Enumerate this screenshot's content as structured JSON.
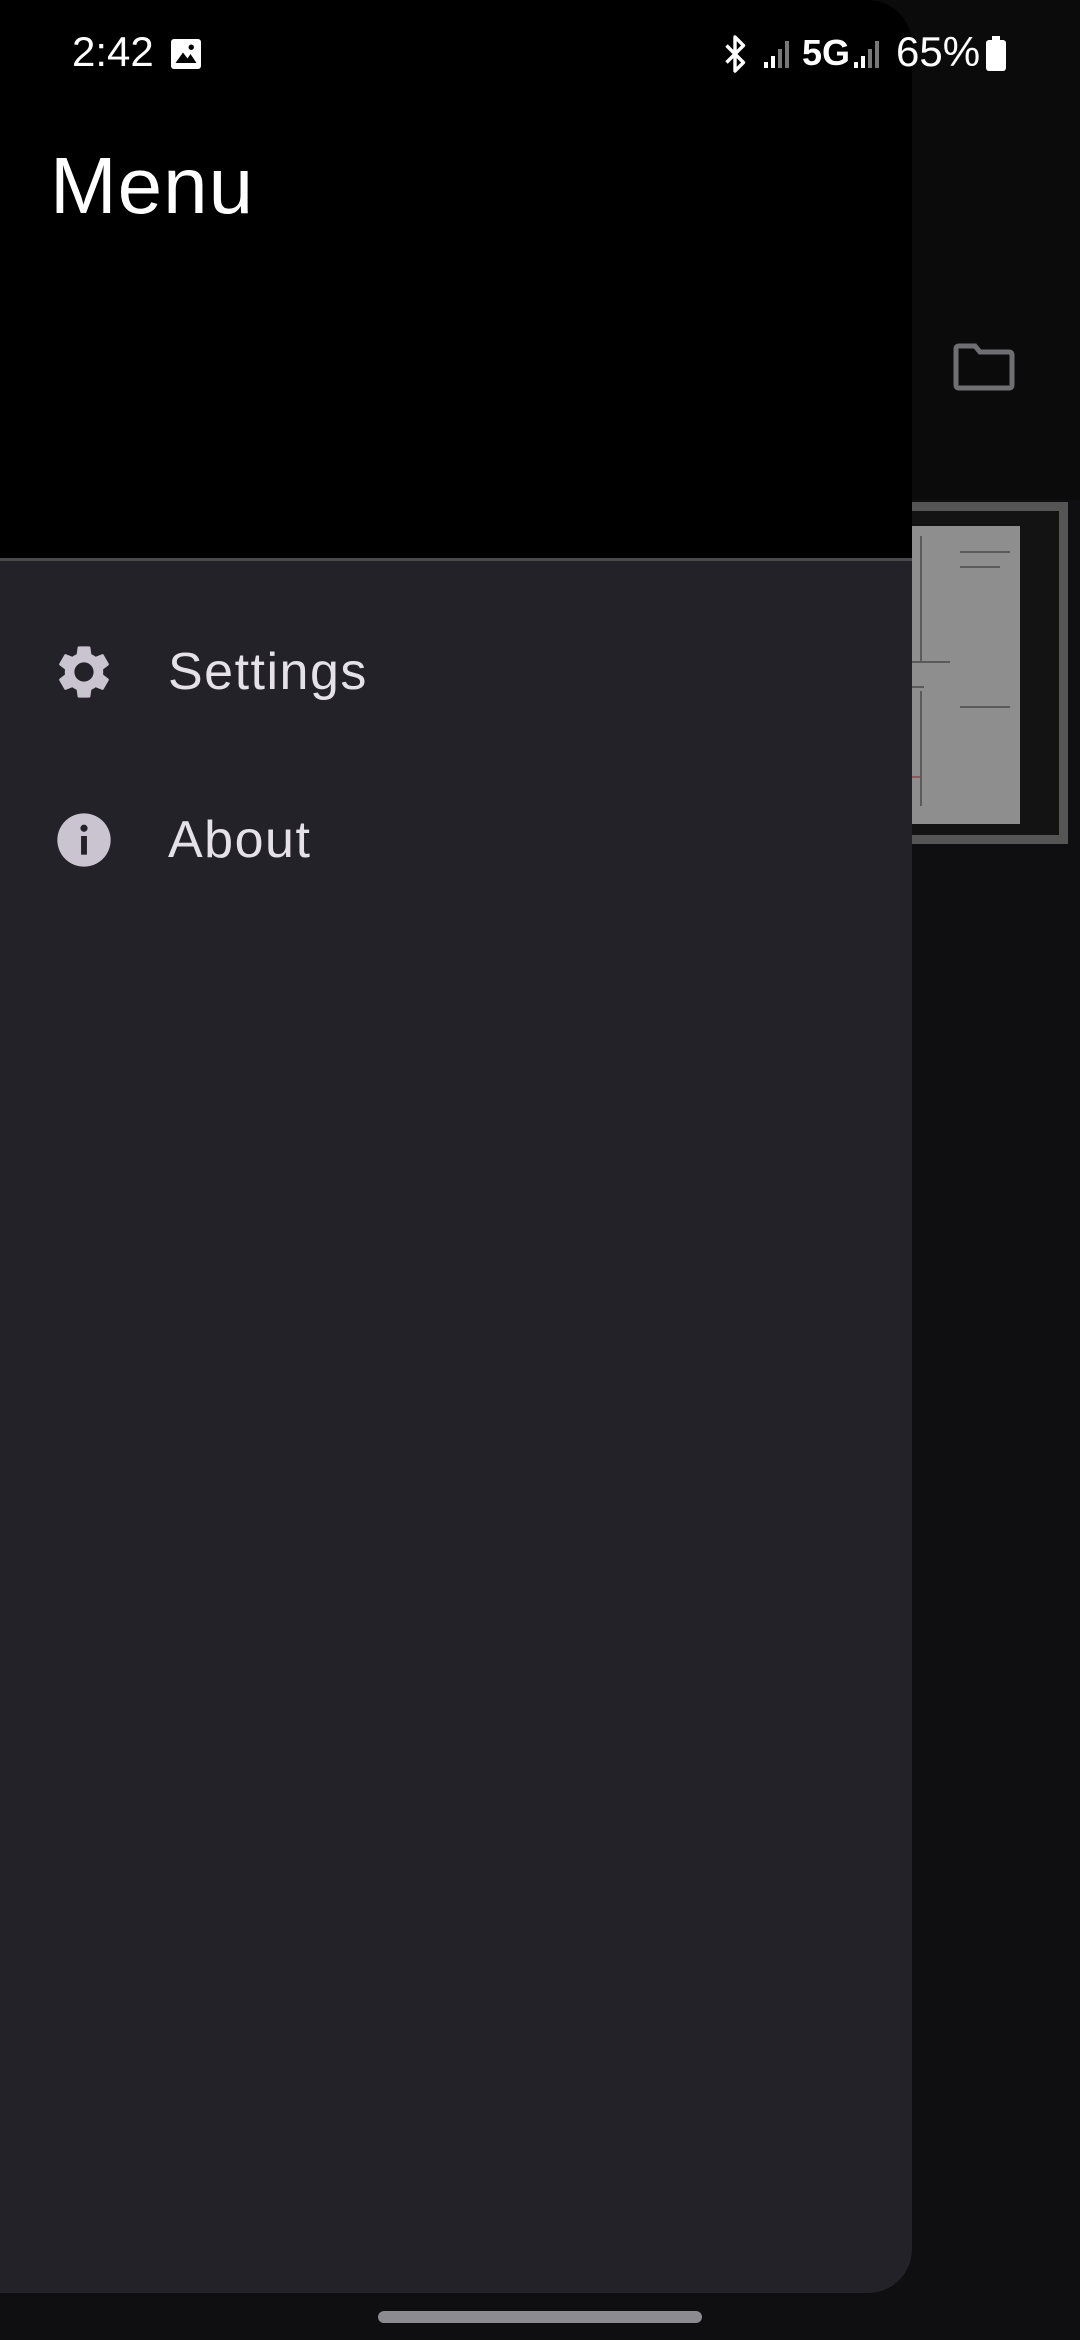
{
  "status_bar": {
    "time": "2:42",
    "network": "5G",
    "battery": "65%",
    "icons": [
      "image-icon",
      "bluetooth-icon",
      "signal-icon",
      "signal-icon",
      "battery-icon"
    ]
  },
  "drawer": {
    "title": "Menu",
    "items": [
      {
        "label": "Settings",
        "icon": "gear-icon"
      },
      {
        "label": "About",
        "icon": "info-icon"
      }
    ]
  },
  "background_app": {
    "icons": [
      "folder-icon"
    ]
  },
  "colors": {
    "drawer_bg": "#232228",
    "header_bg": "#000000",
    "icon_tint": "#cac4d0",
    "text": "#e4e1e8"
  }
}
